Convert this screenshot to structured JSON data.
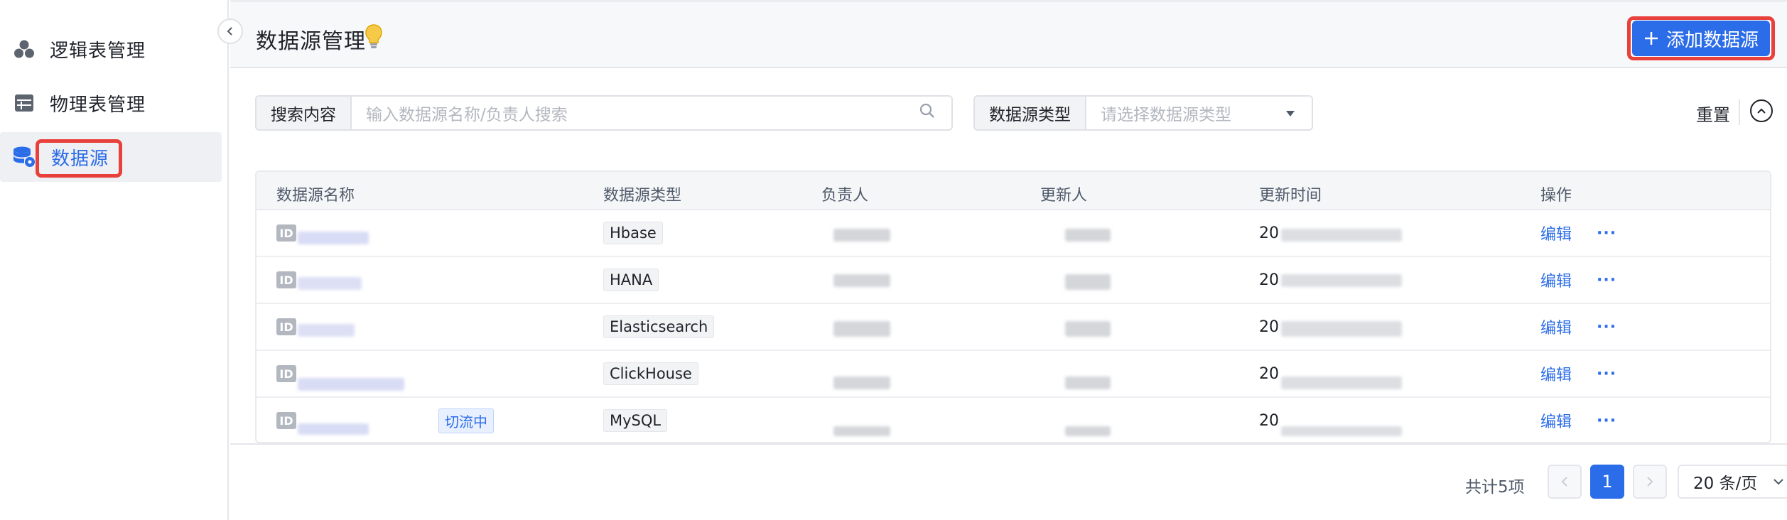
{
  "sidebar": {
    "items": [
      {
        "label": "逻辑表管理",
        "icon": "cluster-icon",
        "active": false
      },
      {
        "label": "物理表管理",
        "icon": "table-icon",
        "active": false
      },
      {
        "label": "数据源",
        "icon": "database-icon",
        "active": true
      }
    ]
  },
  "header": {
    "title": "数据源管理",
    "add_button_label": "添加数据源"
  },
  "filters": {
    "search_label": "搜索内容",
    "search_placeholder": "输入数据源名称/负责人搜索",
    "type_label": "数据源类型",
    "type_placeholder": "请选择数据源类型",
    "reset_label": "重置"
  },
  "table": {
    "columns": [
      "数据源名称",
      "数据源类型",
      "负责人",
      "更新人",
      "更新时间",
      "操作"
    ],
    "rows": [
      {
        "id_badge": "ID",
        "type": "Hbase",
        "time_prefix": "20",
        "edit": "编辑",
        "more": "···",
        "tag": ""
      },
      {
        "id_badge": "ID",
        "type": "HANA",
        "time_prefix": "20",
        "edit": "编辑",
        "more": "···",
        "tag": ""
      },
      {
        "id_badge": "ID",
        "type": "Elasticsearch",
        "time_prefix": "20",
        "edit": "编辑",
        "more": "···",
        "tag": ""
      },
      {
        "id_badge": "ID",
        "type": "ClickHouse",
        "time_prefix": "20",
        "edit": "编辑",
        "more": "···",
        "tag": ""
      },
      {
        "id_badge": "ID",
        "type": "MySQL",
        "time_prefix": "20",
        "edit": "编辑",
        "more": "···",
        "tag": "切流中"
      }
    ]
  },
  "pagination": {
    "total": "共计5项",
    "current_page": "1",
    "page_size": "20 条/页"
  },
  "colors": {
    "accent": "#2b6ce8",
    "highlight": "#e8403a"
  }
}
